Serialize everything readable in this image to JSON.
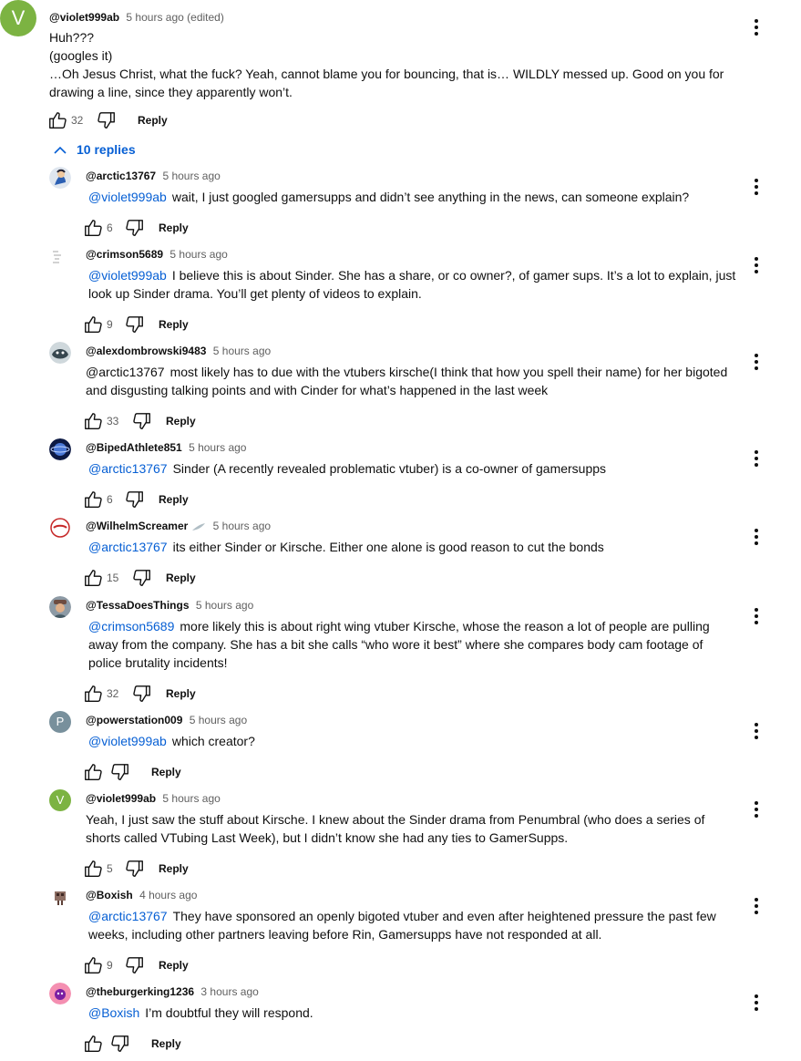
{
  "top_comment": {
    "avatar_letter": "V",
    "author": "@violet999ab",
    "time": "5 hours ago",
    "edited": "(edited)",
    "lines": [
      "Huh???",
      "(googles it)",
      "…Oh Jesus Christ, what the fuck? Yeah, cannot blame you for bouncing, that is… WILDLY messed up. Good on you for drawing a line, since they apparently won’t."
    ],
    "likes": "32",
    "reply_label": "Reply"
  },
  "replies_toggle": {
    "label": "10 replies",
    "icon": "chevron-up-icon"
  },
  "replies": [
    {
      "author": "@arctic13767",
      "time": "5 hours ago",
      "mention": "@violet999ab",
      "text": "wait, I just googled gamersupps and didn’t see anything in the news, can someone explain?",
      "likes": "6",
      "reply_label": "Reply",
      "avatar": "blue-character-avatar"
    },
    {
      "author": "@crimson5689",
      "time": "5 hours ago",
      "mention": "@violet999ab",
      "text": "I believe this is about Sinder.  She has a share, or co owner?, of gamer sups. It’s a lot to explain, just look up Sinder drama. You’ll get plenty of videos to explain.",
      "likes": "9",
      "reply_label": "Reply",
      "avatar": "handwritten-avatar"
    },
    {
      "author": "@alexdombrowski9483",
      "time": "5 hours ago",
      "mention": "@arctic13767",
      "mention_dark": true,
      "text": "most likely has to due with the vtubers kirsche(I think that how you spell their name) for her bigoted and disgusting talking points and with Cinder for what’s happened in the last week",
      "likes": "33",
      "reply_label": "Reply",
      "avatar": "anime-avatar"
    },
    {
      "author": "@BipedAthlete851",
      "time": "5 hours ago",
      "mention": "@arctic13767",
      "text": "Sinder (A recently revealed problematic vtuber) is a co-owner of gamersupps",
      "likes": "6",
      "reply_label": "Reply",
      "avatar": "planet-avatar"
    },
    {
      "author": "@WilhelmScreamer",
      "time": "5 hours ago",
      "mention": "@arctic13767",
      "text": "its either Sinder or Kirsche.  Either one alone is good reason to cut the bonds",
      "likes": "15",
      "reply_label": "Reply",
      "avatar": "red-logo-avatar",
      "badge": "feather-icon"
    },
    {
      "author": "@TessaDoesThings",
      "time": "5 hours ago",
      "mention": "@crimson5689",
      "text": "more likely this is about right wing vtuber Kirsche, whose the reason a lot of people are pulling away from the company. She has a bit she calls “who wore it best” where she compares body cam footage of police brutality incidents!",
      "likes": "32",
      "reply_label": "Reply",
      "avatar": "person-hat-avatar"
    },
    {
      "author": "@powerstation009",
      "time": "5 hours ago",
      "mention": "@violet999ab",
      "text": "which creator?",
      "likes": "",
      "reply_label": "Reply",
      "avatar_letter": "P",
      "avatar_color": "#78909c"
    },
    {
      "author": "@violet999ab",
      "time": "5 hours ago",
      "mention": "",
      "text": "Yeah, I just saw the stuff about Kirsche. I knew about the Sinder drama from Penumbral (who does a series of shorts called VTubing Last Week), but I didn’t know she had any ties to GamerSupps.",
      "likes": "5",
      "reply_label": "Reply",
      "avatar_letter": "V",
      "avatar_color": "#7cb342"
    },
    {
      "author": "@Boxish",
      "time": "4 hours ago",
      "mention": "@arctic13767",
      "text": "They have sponsored an openly bigoted vtuber and even after heightened pressure the past few weeks, including other partners leaving before Rin, Gamersupps have not responded at all.",
      "likes": "9",
      "reply_label": "Reply",
      "avatar": "pixel-art-avatar"
    },
    {
      "author": "@theburgerking1236",
      "time": "3 hours ago",
      "mention": "@Boxish",
      "text": "I’m doubtful they will respond.",
      "likes": "",
      "reply_label": "Reply",
      "avatar": "pink-character-avatar"
    }
  ],
  "colors": {
    "link": "#065fd4",
    "muted": "#606060",
    "text": "#0f0f0f"
  }
}
